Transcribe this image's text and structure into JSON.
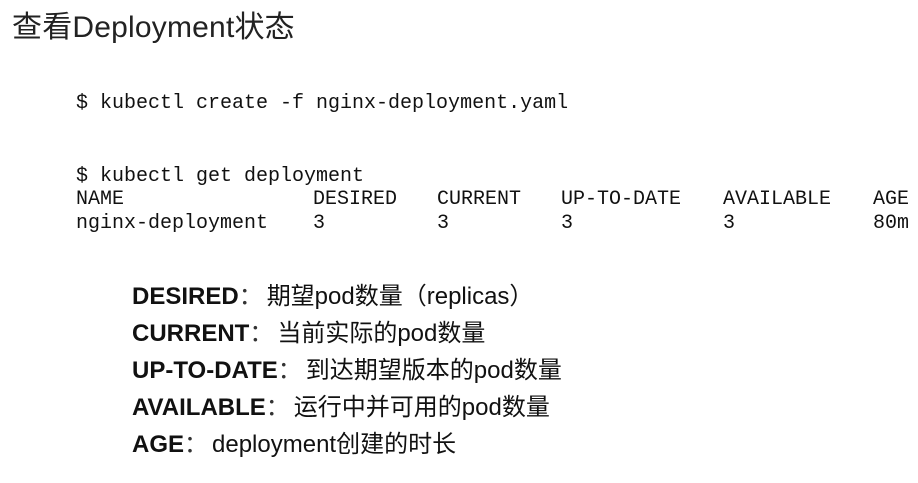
{
  "title": "查看Deployment状态",
  "commands": {
    "create": "$ kubectl create -f nginx-deployment.yaml",
    "get": "$ kubectl get deployment"
  },
  "table": {
    "headers": [
      "NAME",
      "DESIRED",
      "CURRENT",
      "UP-TO-DATE",
      "AVAILABLE",
      "AGE"
    ],
    "rows": [
      [
        "nginx-deployment",
        "3",
        "3",
        "3",
        "3",
        "80m"
      ]
    ]
  },
  "definitions": [
    {
      "term": "DESIRED",
      "sep": "：",
      "text": "期望pod数量（replicas）"
    },
    {
      "term": "CURRENT",
      "sep": "：",
      "text": "当前实际的pod数量"
    },
    {
      "term": "UP-TO-DATE",
      "sep": "：",
      "text": "到达期望版本的pod数量"
    },
    {
      "term": "AVAILABLE",
      "sep": "：",
      "text": "运行中并可用的pod数量"
    },
    {
      "term": "AGE",
      "sep": "：",
      "text": "deployment创建的时长"
    }
  ]
}
